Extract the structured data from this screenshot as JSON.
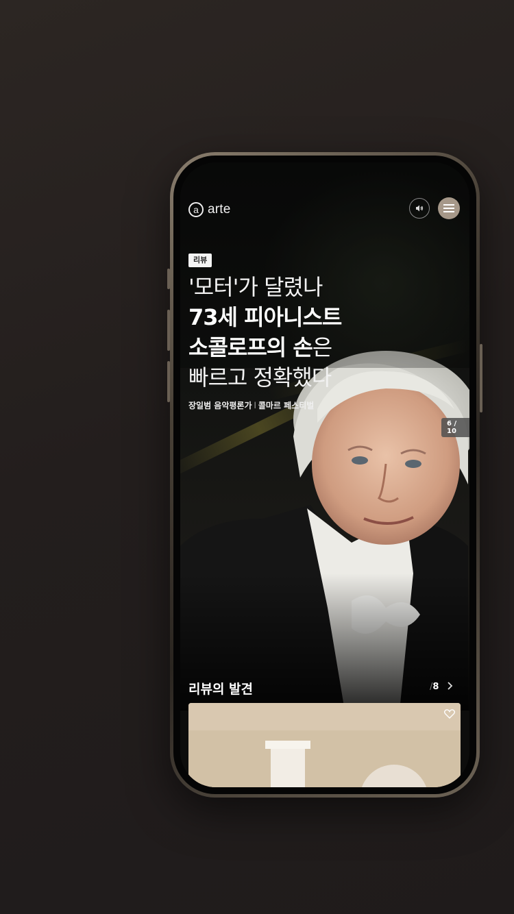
{
  "header": {
    "logo_mark": "a",
    "logo_text": "arte",
    "sound_icon": "speaker-icon",
    "menu_icon": "hamburger-icon"
  },
  "hero": {
    "tag": "리뷰",
    "headline": {
      "line1": "'모터'가 달렸나",
      "line2": "73세 피아니스트",
      "line3_bold": "소콜로프의 손",
      "line3_light": "은",
      "line4": "빠르고 정확했다"
    },
    "byline": {
      "author": "장일범 음악평론가",
      "separator": "l",
      "source": "콜마르 페스티벌"
    },
    "slide_counter": "6 / 10"
  },
  "section": {
    "title": "리뷰의 발견",
    "count_slash": "/",
    "count": "8",
    "arrow_icon": "chevron-right-icon"
  },
  "card": {
    "heart_icon": "heart-icon"
  },
  "colors": {
    "background": "#231e1d",
    "menu_button": "#a69889",
    "tag_bg": "#f4f4f4"
  }
}
